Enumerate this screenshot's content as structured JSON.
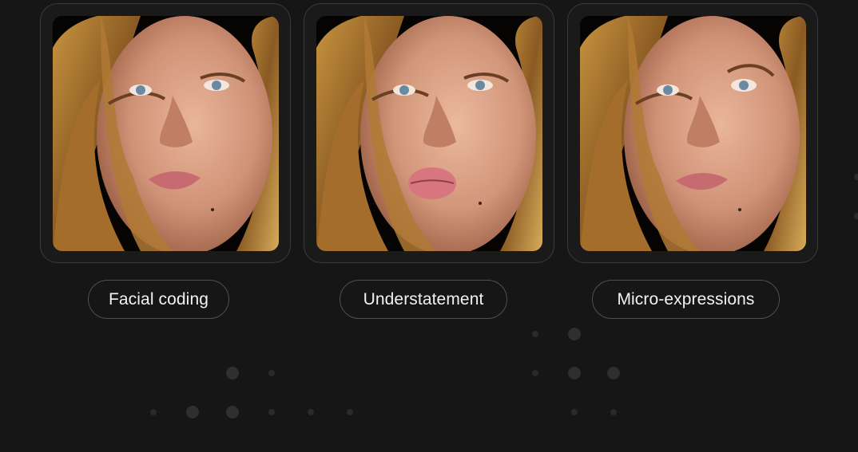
{
  "cards": [
    {
      "label": "Facial coding",
      "expression": "neutral"
    },
    {
      "label": "Understatement",
      "expression": "pout"
    },
    {
      "label": "Micro-expressions",
      "expression": "raised-brow"
    }
  ],
  "colors": {
    "background": "#161616",
    "card_border": "#3b3b3d",
    "pill_border": "#505052",
    "pill_text": "#f2f2f2",
    "dots": "#2c2c2e"
  }
}
